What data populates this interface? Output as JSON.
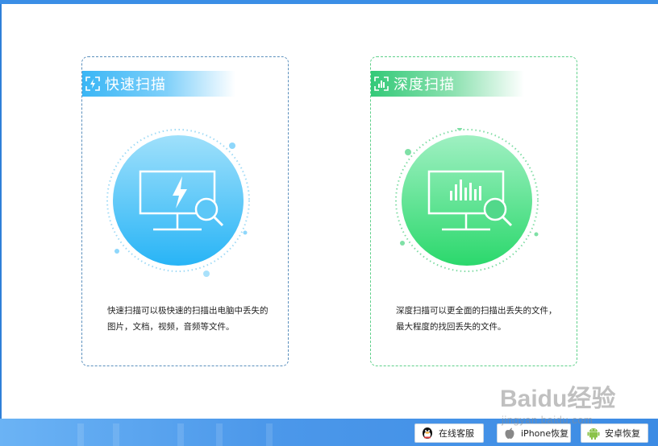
{
  "cards": {
    "quick": {
      "title": "快速扫描",
      "header_icon": "lightning-scan-icon",
      "illustration": "monitor-lightning-magnifier-icon",
      "description": "快速扫描可以极快速的扫描出电脑中丢失的图片，文档，视频，音频等文件。",
      "accent": "#3ab6f5"
    },
    "deep": {
      "title": "深度扫描",
      "header_icon": "chart-scan-icon",
      "illustration": "monitor-bars-magnifier-icon",
      "description": "深度扫描可以更全面的扫描出丢失的文件，最大程度的找回丢失的文件。",
      "accent": "#33c978"
    }
  },
  "footer": {
    "buttons": [
      {
        "label": "在线客服",
        "icon": "qq-penguin-icon"
      },
      {
        "label": "iPhone恢复",
        "icon": "apple-icon"
      },
      {
        "label": "安卓恢复",
        "icon": "android-icon"
      }
    ]
  },
  "watermark": {
    "logo_text": "Baidu经验",
    "url": "jingyan.baidu.com"
  },
  "colors": {
    "top_bar": "#3a8ee6",
    "footer_bar": "#4c98ea",
    "quick_border": "#5a8fbd",
    "deep_border": "#5ed08a"
  }
}
